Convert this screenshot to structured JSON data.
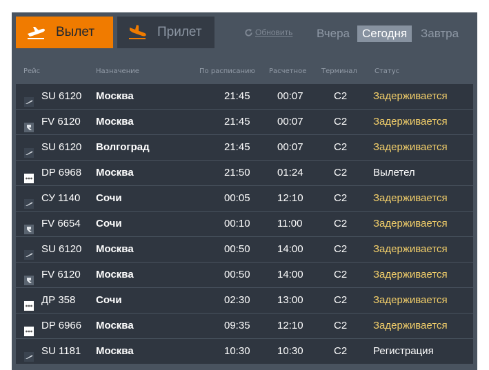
{
  "tabs": {
    "departure": "Вылет",
    "arrival": "Прилет"
  },
  "refresh_label": "Обновить",
  "days": {
    "yesterday": "Вчера",
    "today": "Сегодня",
    "tomorrow": "Завтра",
    "selected": "today"
  },
  "columns": {
    "flight": "Рейс",
    "destination": "Назначение",
    "scheduled": "По расписанию",
    "estimated": "Расчетное",
    "terminal": "Терминал",
    "status": "Статус"
  },
  "colors": {
    "accent": "#f07b00",
    "board_bg": "#49535f",
    "row_bg": "#2f3640",
    "delay_status": "#f3cf6a"
  },
  "flights": [
    {
      "airline_icon": "aeroflot-logo-icon",
      "flight": "SU 6120",
      "destination": "Москва",
      "scheduled": "21:45",
      "estimated": "00:07",
      "terminal": "C2",
      "status": "Задерживается",
      "status_type": "delay"
    },
    {
      "airline_icon": "rossiya-logo-icon",
      "flight": "FV 6120",
      "destination": "Москва",
      "scheduled": "21:45",
      "estimated": "00:07",
      "terminal": "C2",
      "status": "Задерживается",
      "status_type": "delay"
    },
    {
      "airline_icon": "aeroflot-logo-icon",
      "flight": "SU 6120",
      "destination": "Волгоград",
      "scheduled": "21:45",
      "estimated": "00:07",
      "terminal": "C2",
      "status": "Задерживается",
      "status_type": "delay"
    },
    {
      "airline_icon": "pobeda-logo-icon",
      "flight": "DP 6968",
      "destination": "Москва",
      "scheduled": "21:50",
      "estimated": "01:24",
      "terminal": "C2",
      "status": "Вылетел",
      "status_type": "ok"
    },
    {
      "airline_icon": "aeroflot-logo-icon",
      "flight": "СУ 1140",
      "destination": "Сочи",
      "scheduled": "00:05",
      "estimated": "12:10",
      "terminal": "C2",
      "status": "Задерживается",
      "status_type": "delay"
    },
    {
      "airline_icon": "rossiya-logo-icon",
      "flight": "FV 6654",
      "destination": "Сочи",
      "scheduled": "00:10",
      "estimated": "11:00",
      "terminal": "C2",
      "status": "Задерживается",
      "status_type": "delay"
    },
    {
      "airline_icon": "aeroflot-logo-icon",
      "flight": "SU 6120",
      "destination": "Москва",
      "scheduled": "00:50",
      "estimated": "14:00",
      "terminal": "C2",
      "status": "Задерживается",
      "status_type": "delay"
    },
    {
      "airline_icon": "rossiya-logo-icon",
      "flight": "FV 6120",
      "destination": "Москва",
      "scheduled": "00:50",
      "estimated": "14:00",
      "terminal": "C2",
      "status": "Задерживается",
      "status_type": "delay"
    },
    {
      "airline_icon": "pobeda-logo-icon",
      "flight": "ДР 358",
      "destination": "Сочи",
      "scheduled": "02:30",
      "estimated": "13:00",
      "terminal": "C2",
      "status": "Задерживается",
      "status_type": "delay"
    },
    {
      "airline_icon": "pobeda-logo-icon",
      "flight": "DP 6966",
      "destination": "Москва",
      "scheduled": "09:35",
      "estimated": "12:10",
      "terminal": "C2",
      "status": "Задерживается",
      "status_type": "delay"
    },
    {
      "airline_icon": "aeroflot-logo-icon",
      "flight": "SU 1181",
      "destination": "Москва",
      "scheduled": "10:30",
      "estimated": "10:30",
      "terminal": "C2",
      "status": "Регистрация",
      "status_type": "ok"
    }
  ]
}
